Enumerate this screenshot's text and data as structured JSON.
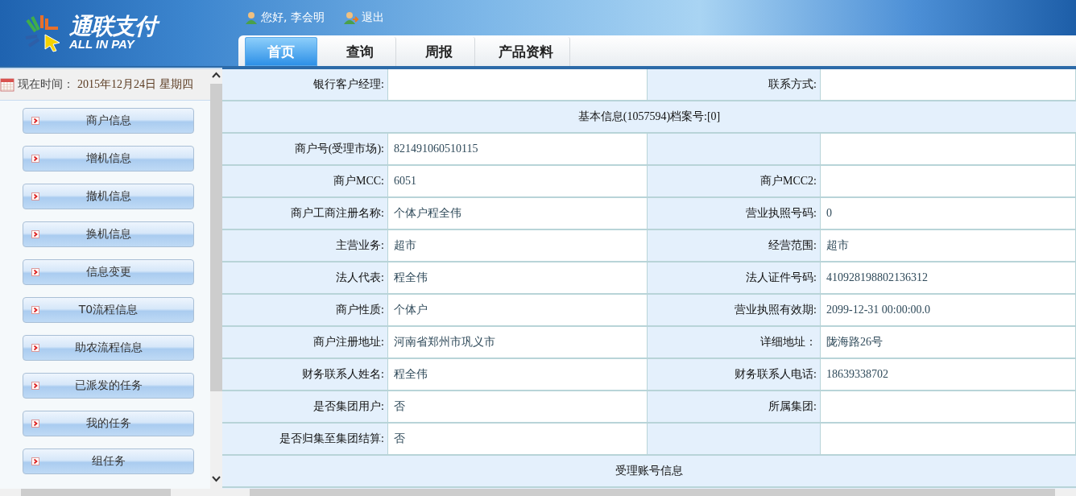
{
  "header": {
    "logo": {
      "name": "通联支付",
      "tagline": "ALL IN PAY"
    },
    "greeting": "您好, 李会明",
    "logout": "退出"
  },
  "tabs": [
    {
      "label": "首页",
      "selected": true
    },
    {
      "label": "查询",
      "selected": false
    },
    {
      "label": "周报",
      "selected": false
    },
    {
      "label": "产品资料",
      "selected": false
    }
  ],
  "sidebar": {
    "time_label": "现在时间：",
    "time_value": "2015年12月24日 星期四",
    "items": [
      "商户信息",
      "增机信息",
      "撤机信息",
      "换机信息",
      "信息变更",
      "T0流程信息",
      "助农流程信息",
      "已派发的任务",
      "我的任务",
      "组任务"
    ]
  },
  "rows": [
    {
      "kind": "pair",
      "cells": [
        {
          "label": "银行客户经理:"
        },
        {
          "label": "联系方式:"
        }
      ]
    },
    {
      "kind": "section",
      "title": "基本信息(1057594)档案号:[0]"
    },
    {
      "kind": "pair",
      "cells": [
        {
          "label": "商户号(受理市场):",
          "value": "821491060510115"
        },
        {}
      ]
    },
    {
      "kind": "pair",
      "cells": [
        {
          "label": "商户MCC:",
          "value": "6051"
        },
        {
          "label": "商户MCC2:"
        }
      ]
    },
    {
      "kind": "pair",
      "cells": [
        {
          "label": "商户工商注册名称:",
          "value": "个体户程全伟"
        },
        {
          "label": "营业执照号码:",
          "value": "0"
        }
      ]
    },
    {
      "kind": "pair",
      "cells": [
        {
          "label": "主营业务:",
          "value": "超市"
        },
        {
          "label": "经营范围:",
          "value": "超市"
        }
      ]
    },
    {
      "kind": "pair",
      "cells": [
        {
          "label": "法人代表:",
          "value": "程全伟"
        },
        {
          "label": "法人证件号码:",
          "value": "410928198802136312"
        }
      ]
    },
    {
      "kind": "pair",
      "cells": [
        {
          "label": "商户性质:",
          "value": "个体户"
        },
        {
          "label": "营业执照有效期:",
          "value": "2099-12-31 00:00:00.0"
        }
      ]
    },
    {
      "kind": "pair",
      "cells": [
        {
          "label": "商户注册地址:",
          "value": "河南省郑州市巩义市"
        },
        {
          "label": "详细地址：",
          "value": "陇海路26号"
        }
      ]
    },
    {
      "kind": "pair",
      "cells": [
        {
          "label": "财务联系人姓名:",
          "value": "程全伟"
        },
        {
          "label": "财务联系人电话:",
          "value": "18639338702"
        }
      ]
    },
    {
      "kind": "pair",
      "cells": [
        {
          "label": "是否集团用户:",
          "value": "否"
        },
        {
          "label": "所属集团:"
        }
      ]
    },
    {
      "kind": "pair",
      "cells": [
        {
          "label": "是否归集至集团结算:",
          "value": "否"
        },
        {}
      ]
    },
    {
      "kind": "section",
      "title": "受理账号信息"
    }
  ]
}
